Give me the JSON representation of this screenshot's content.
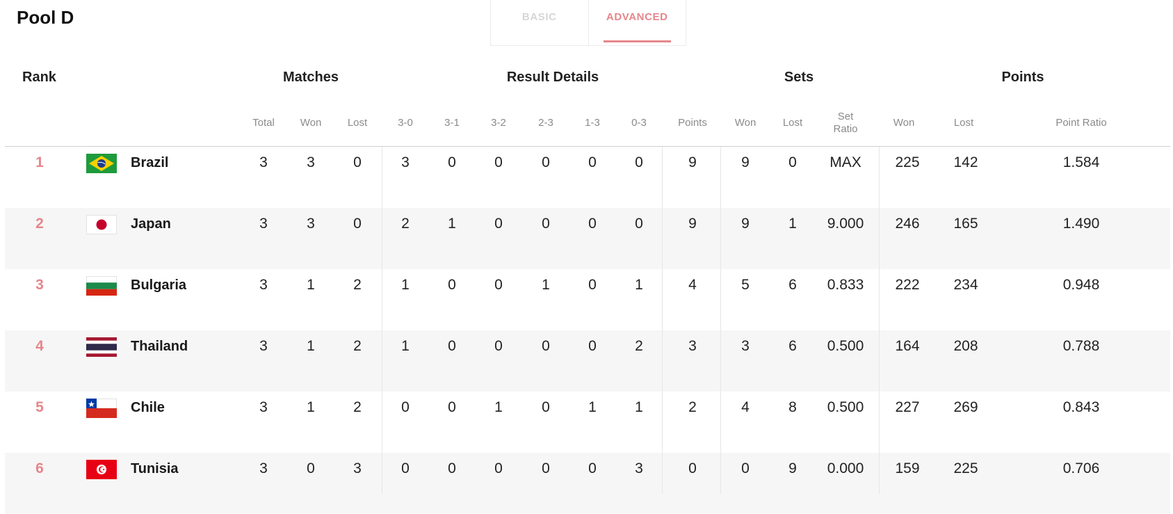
{
  "pool_title": "Pool D",
  "tabs": {
    "basic": "BASIC",
    "advanced": "ADVANCED"
  },
  "groups": {
    "rank": "Rank",
    "matches": "Matches",
    "result_details": "Result Details",
    "sets": "Sets",
    "points": "Points"
  },
  "subheaders": {
    "total": "Total",
    "won": "Won",
    "lost": "Lost",
    "r30": "3-0",
    "r31": "3-1",
    "r32": "3-2",
    "r23": "2-3",
    "r13": "1-3",
    "r03": "0-3",
    "points": "Points",
    "sets_won": "Won",
    "sets_lost": "Lost",
    "set_ratio_1": "Set",
    "set_ratio_2": "Ratio",
    "pts_won": "Won",
    "pts_lost": "Lost",
    "point_ratio": "Point Ratio"
  },
  "rows": [
    {
      "rank": "1",
      "team": "Brazil",
      "flag": "brazil-flag",
      "total": "3",
      "won": "3",
      "lost": "0",
      "r30": "3",
      "r31": "0",
      "r32": "0",
      "r23": "0",
      "r13": "0",
      "r03": "0",
      "points": "9",
      "sets_won": "9",
      "sets_lost": "0",
      "set_ratio": "MAX",
      "pts_won": "225",
      "pts_lost": "142",
      "point_ratio": "1.584"
    },
    {
      "rank": "2",
      "team": "Japan",
      "flag": "japan-flag",
      "total": "3",
      "won": "3",
      "lost": "0",
      "r30": "2",
      "r31": "1",
      "r32": "0",
      "r23": "0",
      "r13": "0",
      "r03": "0",
      "points": "9",
      "sets_won": "9",
      "sets_lost": "1",
      "set_ratio": "9.000",
      "pts_won": "246",
      "pts_lost": "165",
      "point_ratio": "1.490"
    },
    {
      "rank": "3",
      "team": "Bulgaria",
      "flag": "bulgaria-flag",
      "total": "3",
      "won": "1",
      "lost": "2",
      "r30": "1",
      "r31": "0",
      "r32": "0",
      "r23": "1",
      "r13": "0",
      "r03": "1",
      "points": "4",
      "sets_won": "5",
      "sets_lost": "6",
      "set_ratio": "0.833",
      "pts_won": "222",
      "pts_lost": "234",
      "point_ratio": "0.948"
    },
    {
      "rank": "4",
      "team": "Thailand",
      "flag": "thailand-flag",
      "total": "3",
      "won": "1",
      "lost": "2",
      "r30": "1",
      "r31": "0",
      "r32": "0",
      "r23": "0",
      "r13": "0",
      "r03": "2",
      "points": "3",
      "sets_won": "3",
      "sets_lost": "6",
      "set_ratio": "0.500",
      "pts_won": "164",
      "pts_lost": "208",
      "point_ratio": "0.788"
    },
    {
      "rank": "5",
      "team": "Chile",
      "flag": "chile-flag",
      "total": "3",
      "won": "1",
      "lost": "2",
      "r30": "0",
      "r31": "0",
      "r32": "1",
      "r23": "0",
      "r13": "1",
      "r03": "1",
      "points": "2",
      "sets_won": "4",
      "sets_lost": "8",
      "set_ratio": "0.500",
      "pts_won": "227",
      "pts_lost": "269",
      "point_ratio": "0.843"
    },
    {
      "rank": "6",
      "team": "Tunisia",
      "flag": "tunisia-flag",
      "total": "3",
      "won": "0",
      "lost": "3",
      "r30": "0",
      "r31": "0",
      "r32": "0",
      "r23": "0",
      "r13": "0",
      "r03": "3",
      "points": "0",
      "sets_won": "0",
      "sets_lost": "9",
      "set_ratio": "0.000",
      "pts_won": "159",
      "pts_lost": "225",
      "point_ratio": "0.706"
    }
  ],
  "colors": {
    "accent": "#e5868c",
    "row_alt": "#f6f6f6",
    "muted_tab": "#d6d6d6"
  }
}
